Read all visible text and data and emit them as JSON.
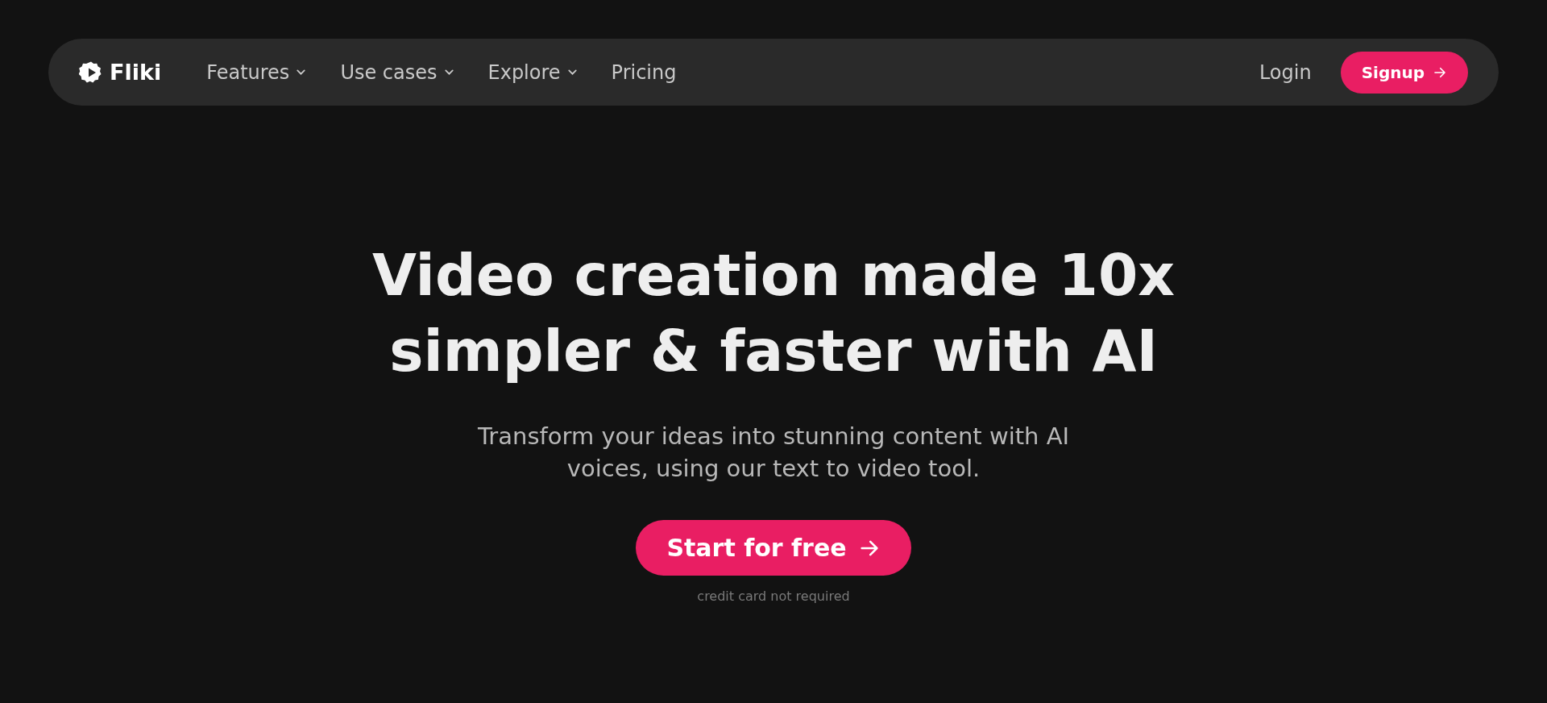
{
  "nav": {
    "logo": "Fliki",
    "items": [
      {
        "label": "Features",
        "has_menu": true
      },
      {
        "label": "Use cases",
        "has_menu": true
      },
      {
        "label": "Explore",
        "has_menu": true
      },
      {
        "label": "Pricing",
        "has_menu": false
      }
    ],
    "login": "Login",
    "signup": "Signup"
  },
  "hero": {
    "title_lines": [
      "Video creation made 10x",
      "simpler & faster with AI"
    ],
    "subtitle": "Transform your ideas into stunning content with AI voices, using our text to video tool.",
    "cta": "Start for free",
    "note": "credit card not required"
  }
}
